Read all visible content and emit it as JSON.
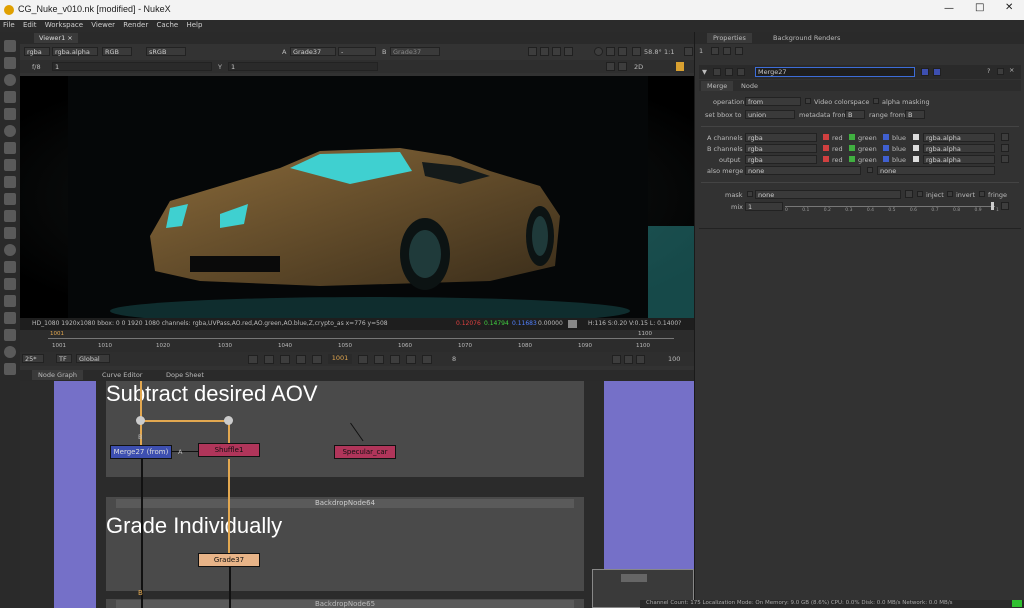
{
  "window": {
    "title": "CG_Nuke_v010.nk [modified] - NukeX"
  },
  "menu": [
    "File",
    "Edit",
    "Workspace",
    "Viewer",
    "Render",
    "Cache",
    "Help"
  ],
  "viewer": {
    "tab": "Viewer1",
    "channels": "rgba",
    "alpha": "rgba.alpha",
    "colorspace_space": "RGB",
    "display": "sRGB",
    "a_input": "Grade37",
    "a_extra": "-",
    "b_input": "Grade37",
    "zoom": "58.8°",
    "ratio": "1:1",
    "frame_label": "f/8",
    "frame_val": "1",
    "y_label": "Y",
    "y_val": "1",
    "view_mode": "2D",
    "info": "HD_1080 1920x1080  bbox: 0 0 1920 1080 channels: rgba,UVPass,AO.red,AO.green,AO.blue,Z,crypto_as  x=776 y=508",
    "pix_r": "0.12076",
    "pix_g": "0.14794",
    "pix_b": "0.11683",
    "pix_a": "0.00000",
    "hsvl": "H:116 S:0.20 V:0.15  L: 0.1400?"
  },
  "timeline": {
    "ticks": [
      "1001",
      "1010",
      "1020",
      "1030",
      "1040",
      "1050",
      "1060",
      "1070",
      "1080",
      "1090",
      "1100"
    ],
    "fps": "25*",
    "tf": "TF",
    "global": "Global",
    "current": "1001",
    "step": "8",
    "end": "100",
    "start_marker": "1001",
    "end_marker": "1100"
  },
  "bottom_tabs": [
    "Node Graph",
    "Curve Editor",
    "Dope Sheet"
  ],
  "graph": {
    "backdrop1_text": "Subtract desired AOV",
    "backdrop2_title": "BackdropNode64",
    "backdrop2_text": "Grade Individually",
    "backdrop3_title": "BackdropNode65",
    "nodes": {
      "merge": "Merge27 (from)",
      "shuffle": "Shuffle1",
      "specular": "Specular_car",
      "grade": "Grade37"
    },
    "pin_a": "A",
    "pin_b": "B",
    "pin_b2": "B"
  },
  "status": "Channel Count: 175 Localization Mode: On Memory: 9.0 GB (8.6%) CPU: 0.0% Disk: 0.0 MB/s Network: 0.0 MB/s",
  "properties": {
    "tabs": [
      "Properties",
      "Background Renders"
    ],
    "node_name": "Merge27",
    "subtabs": [
      "Merge",
      "Node"
    ],
    "operation_label": "operation",
    "operation": "from",
    "video_colorspace": "Video colorspace",
    "alpha_masking": "alpha masking",
    "bbox_label": "set bbox to",
    "bbox": "union",
    "metadata_label": "metadata from",
    "metadata": "B",
    "range_label": "range from",
    "range": "B",
    "rows": [
      {
        "label": "A channels",
        "value": "rgba",
        "alpha": "rgba.alpha"
      },
      {
        "label": "B channels",
        "value": "rgba",
        "alpha": "rgba.alpha"
      },
      {
        "label": "output",
        "value": "rgba",
        "alpha": "rgba.alpha"
      }
    ],
    "chan_red": "red",
    "chan_green": "green",
    "chan_blue": "blue",
    "also_merge_label": "also merge",
    "also_merge": "none",
    "also_merge2": "none",
    "mask_label": "mask",
    "mask": "none",
    "inject": "inject",
    "invert": "invert",
    "fringe": "fringe",
    "mix_label": "mix",
    "mix": "1",
    "mix_ticks": [
      "0",
      "0.1",
      "0.2",
      "0.3",
      "0.4",
      "0.5",
      "0.6",
      "0.7",
      "0.8",
      "0.9",
      "1"
    ]
  },
  "colors": {
    "accent": "#e3a850",
    "shuffle": "#b0355a",
    "merge": "#3d4fb0",
    "grade": "#e8b488",
    "backdrop": "#4a4a4a",
    "side_backdrop": "#7570c8"
  }
}
